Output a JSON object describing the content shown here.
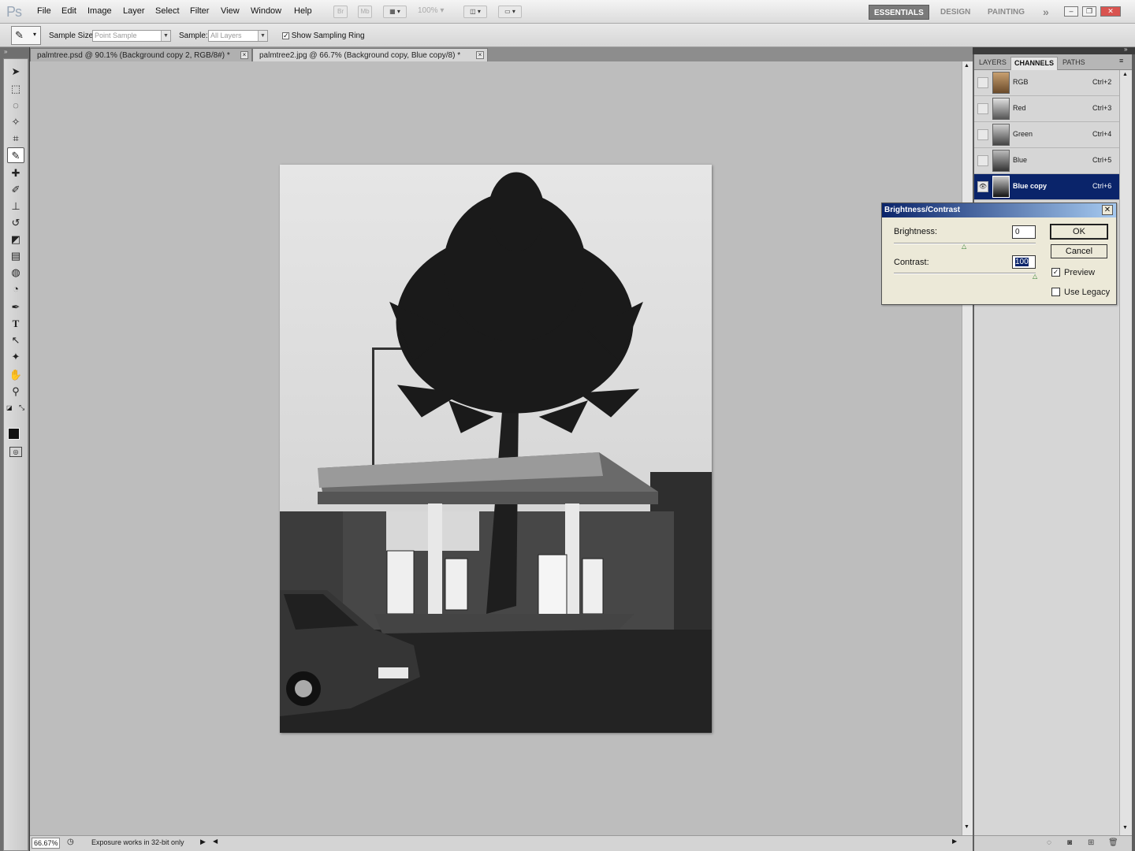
{
  "app": {
    "logo": "Ps",
    "menu": [
      "File",
      "Edit",
      "Image",
      "Layer",
      "Select",
      "Filter",
      "View",
      "Window",
      "Help"
    ],
    "bridge_btn": "Br",
    "minibridge_btn": "Mb",
    "zoom_combo": "100%",
    "workspaces": [
      "ESSENTIALS",
      "DESIGN",
      "PAINTING"
    ],
    "more_workspaces": "»"
  },
  "options_bar": {
    "sample_size_label": "Sample Size:",
    "sample_size_value": "Point Sample",
    "sample_label": "Sample:",
    "sample_value": "All Layers",
    "show_ring_label": "Show Sampling Ring",
    "show_ring_checked": true
  },
  "document_tabs": [
    {
      "label": "palmtree.psd @ 90.1% (Background copy 2, RGB/8#) *",
      "active": false
    },
    {
      "label": "palmtree2.jpg @ 66.7% (Background copy, Blue copy/8) *",
      "active": true
    }
  ],
  "status_bar": {
    "zoom": "66.67%",
    "text": "Exposure works in 32-bit only"
  },
  "panels": {
    "tabs": [
      "LAYERS",
      "CHANNELS",
      "PATHS"
    ],
    "active_tab": "CHANNELS",
    "channels": [
      {
        "name": "RGB",
        "shortcut": "Ctrl+2",
        "visible": false,
        "selected": false
      },
      {
        "name": "Red",
        "shortcut": "Ctrl+3",
        "visible": false,
        "selected": false
      },
      {
        "name": "Green",
        "shortcut": "Ctrl+4",
        "visible": false,
        "selected": false
      },
      {
        "name": "Blue",
        "shortcut": "Ctrl+5",
        "visible": false,
        "selected": false
      },
      {
        "name": "Blue copy",
        "shortcut": "Ctrl+6",
        "visible": true,
        "selected": true
      }
    ]
  },
  "dialog": {
    "title": "Brightness/Contrast",
    "brightness_label": "Brightness:",
    "brightness_value": "0",
    "contrast_label": "Contrast:",
    "contrast_value": "100",
    "ok_label": "OK",
    "cancel_label": "Cancel",
    "preview_label": "Preview",
    "preview_checked": true,
    "legacy_label": "Use Legacy",
    "legacy_checked": false
  },
  "colors": {
    "selection": "#0a246a",
    "canvas_bg": "#bdbdbd",
    "foreground": "#111111",
    "background": "#111111"
  },
  "icons": {
    "tools": [
      "move-icon",
      "marquee-icon",
      "lasso-icon",
      "quick-selection-icon",
      "crop-icon",
      "eyedropper-icon",
      "spot-healing-icon",
      "brush-icon",
      "clone-stamp-icon",
      "history-brush-icon",
      "eraser-icon",
      "gradient-icon",
      "blur-icon",
      "dodge-icon",
      "pen-icon",
      "type-icon",
      "path-selection-icon",
      "shape-icon",
      "hand-icon",
      "zoom-icon"
    ]
  }
}
